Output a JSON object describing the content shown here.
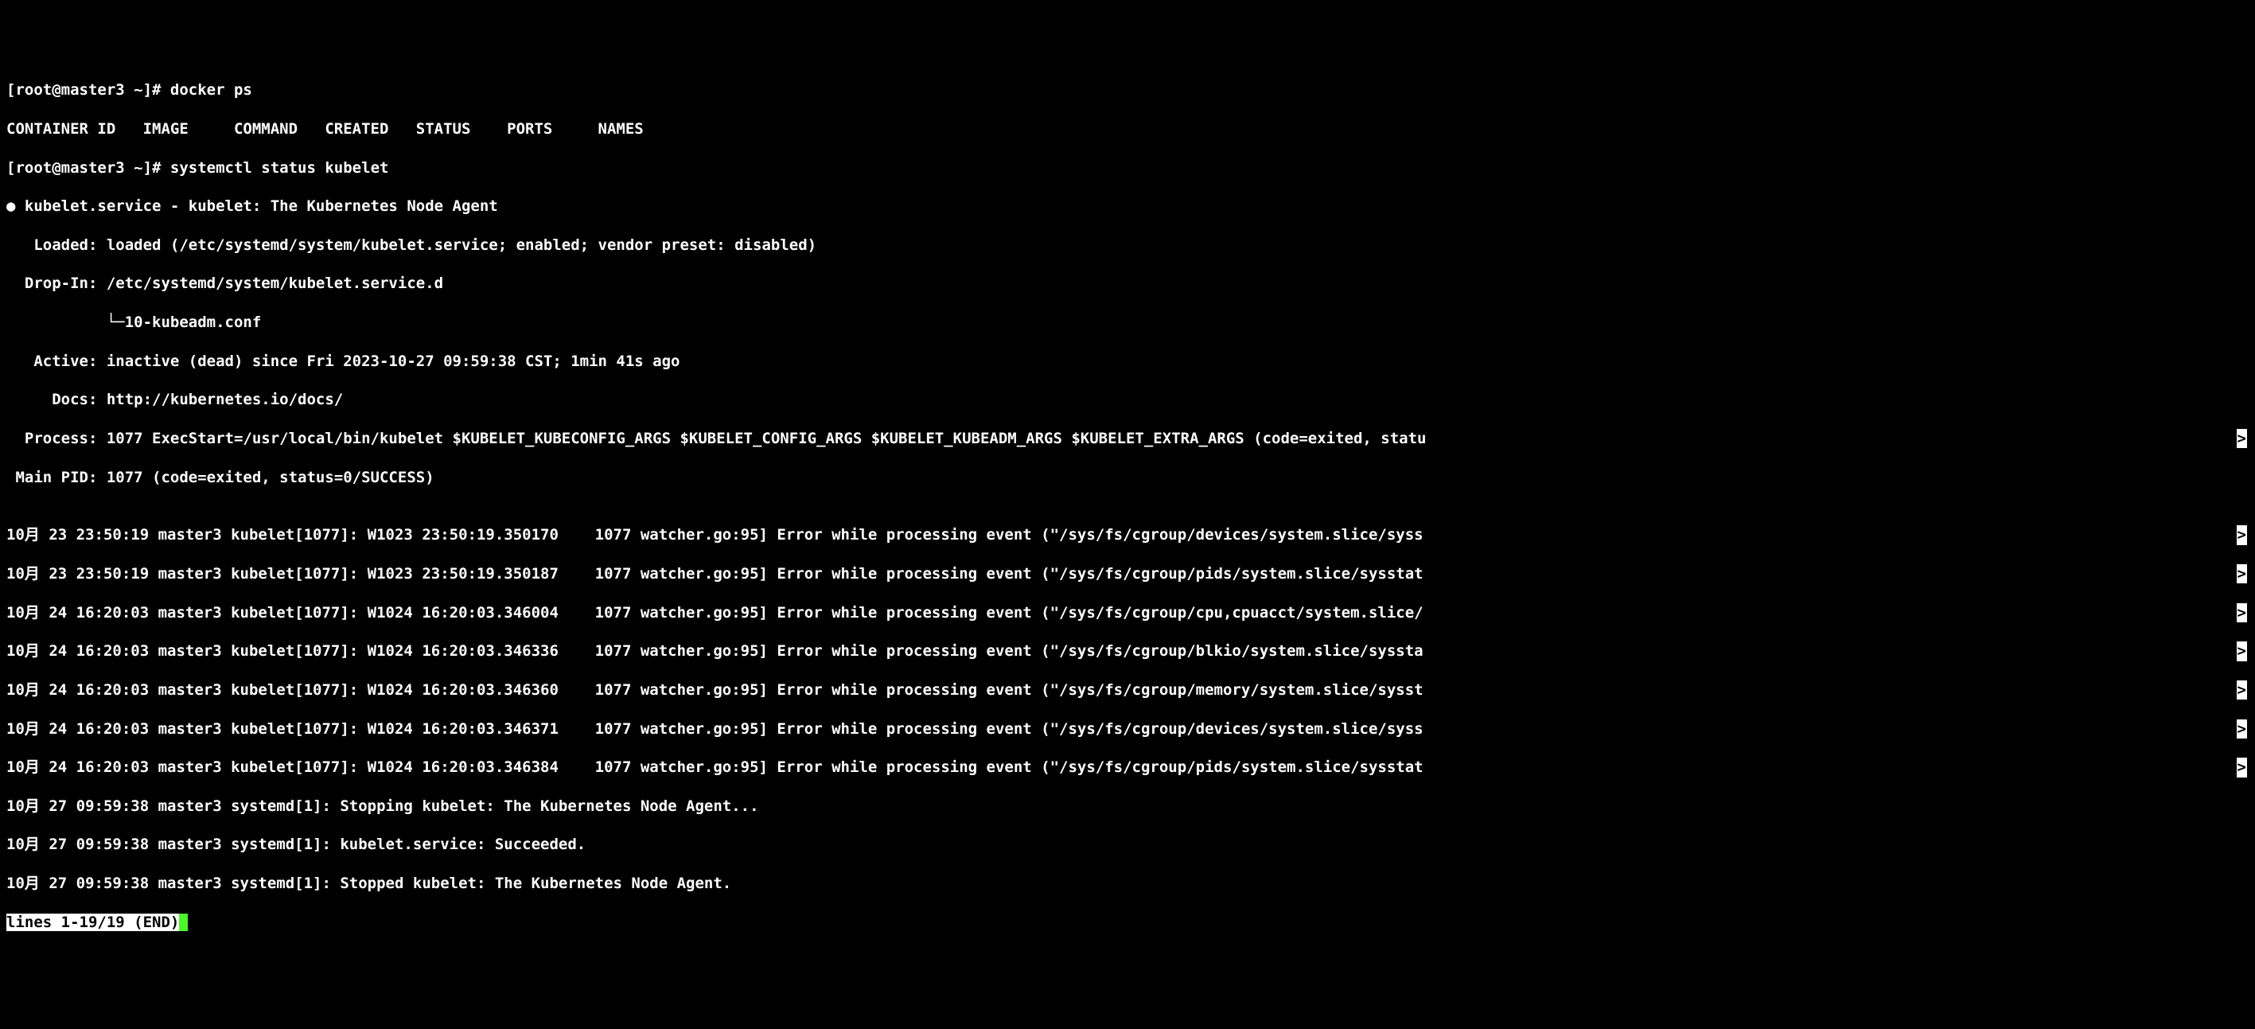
{
  "prompt1": "[root@master3 ~]# ",
  "cmd1": "docker ps",
  "docker_header": "CONTAINER ID   IMAGE     COMMAND   CREATED   STATUS    PORTS     NAMES",
  "prompt2": "[root@master3 ~]# ",
  "cmd2": "systemctl status kubelet",
  "service_line": "● kubelet.service - kubelet: The Kubernetes Node Agent",
  "loaded_line": "   Loaded: loaded (/etc/systemd/system/kubelet.service; enabled; vendor preset: disabled)",
  "dropin_line": "  Drop-In: /etc/systemd/system/kubelet.service.d",
  "dropin_file": "           └─10-kubeadm.conf",
  "active_line": "   Active: inactive (dead) since Fri 2023-10-27 09:59:38 CST; 1min 41s ago",
  "docs_line": "     Docs: http://kubernetes.io/docs/",
  "process_line": "  Process: 1077 ExecStart=/usr/local/bin/kubelet $KUBELET_KUBECONFIG_ARGS $KUBELET_CONFIG_ARGS $KUBELET_KUBEADM_ARGS $KUBELET_EXTRA_ARGS (code=exited, statu",
  "mainpid_line": " Main PID: 1077 (code=exited, status=0/SUCCESS)",
  "blank": "",
  "logs": [
    "10月 23 23:50:19 master3 kubelet[1077]: W1023 23:50:19.350170    1077 watcher.go:95] Error while processing event (\"/sys/fs/cgroup/devices/system.slice/syss",
    "10月 23 23:50:19 master3 kubelet[1077]: W1023 23:50:19.350187    1077 watcher.go:95] Error while processing event (\"/sys/fs/cgroup/pids/system.slice/sysstat",
    "10月 24 16:20:03 master3 kubelet[1077]: W1024 16:20:03.346004    1077 watcher.go:95] Error while processing event (\"/sys/fs/cgroup/cpu,cpuacct/system.slice/",
    "10月 24 16:20:03 master3 kubelet[1077]: W1024 16:20:03.346336    1077 watcher.go:95] Error while processing event (\"/sys/fs/cgroup/blkio/system.slice/syssta",
    "10月 24 16:20:03 master3 kubelet[1077]: W1024 16:20:03.346360    1077 watcher.go:95] Error while processing event (\"/sys/fs/cgroup/memory/system.slice/sysst",
    "10月 24 16:20:03 master3 kubelet[1077]: W1024 16:20:03.346371    1077 watcher.go:95] Error while processing event (\"/sys/fs/cgroup/devices/system.slice/syss",
    "10月 24 16:20:03 master3 kubelet[1077]: W1024 16:20:03.346384    1077 watcher.go:95] Error while processing event (\"/sys/fs/cgroup/pids/system.slice/sysstat",
    "10月 27 09:59:38 master3 systemd[1]: Stopping kubelet: The Kubernetes Node Agent...",
    "10月 27 09:59:38 master3 systemd[1]: kubelet.service: Succeeded.",
    "10月 27 09:59:38 master3 systemd[1]: Stopped kubelet: The Kubernetes Node Agent."
  ],
  "pager_status": "lines 1-19/19 (END)",
  "trunc": ">"
}
